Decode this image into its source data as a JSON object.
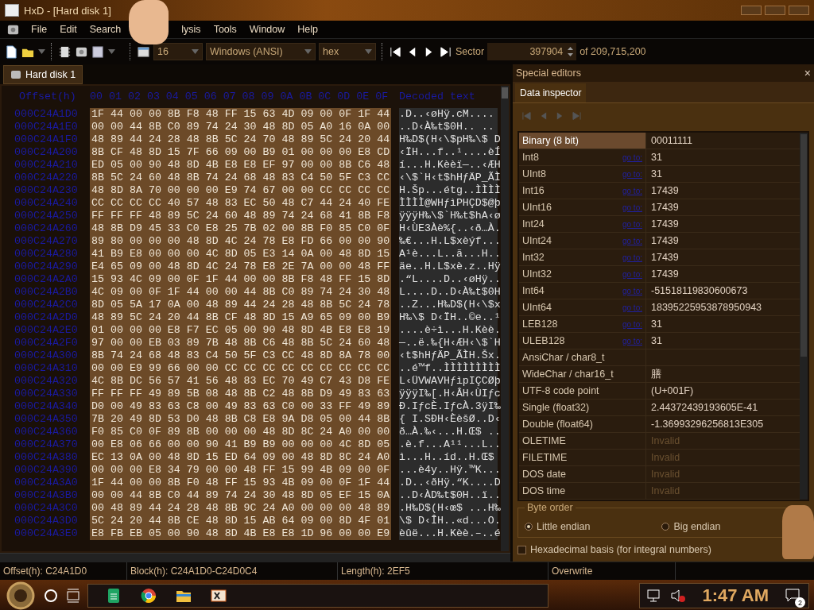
{
  "window": {
    "title": "HxD - [Hard disk 1]"
  },
  "menu": [
    "File",
    "Edit",
    "Search",
    "lysis",
    "Tools",
    "Window",
    "Help"
  ],
  "toolbar": {
    "bytes_per_row": "16",
    "charset": "Windows (ANSI)",
    "offset_base": "hex",
    "sector_label": "Sector",
    "sector": "397904",
    "sector_total": "of 209,715,200"
  },
  "tabs": [
    {
      "label": "Hard disk 1",
      "selected": true
    }
  ],
  "hex_view": {
    "offset_header": "Offset(h)",
    "columns": [
      "00",
      "01",
      "02",
      "03",
      "04",
      "05",
      "06",
      "07",
      "08",
      "09",
      "0A",
      "0B",
      "0C",
      "0D",
      "0E",
      "0F"
    ],
    "decoded_header": "Decoded text",
    "rows": [
      {
        "offset": "000C24A1D0",
        "bytes": "1F 44 00 00 8B F8 48 FF 15 63 4D 09 00 0F 1F 44",
        "text": ".D..‹øHÿ.cM...."
      },
      {
        "offset": "000C24A1E0",
        "bytes": "00 00 44 8B C0 89 74 24 30 48 8D 05 A0 16 0A 00",
        "text": "..D‹À‰t$0H.. .."
      },
      {
        "offset": "000C24A1F0",
        "bytes": "48 89 44 24 28 48 8B 5C 24 70 48 89 5C 24 20 44",
        "text": "H‰D$(H‹\\$pH‰\\$ D"
      },
      {
        "offset": "000C24A200",
        "bytes": "8B CF 48 8D 15 7F 66 09 00 B9 01 00 00 00 E8 CD",
        "text": "‹ÏH...f..¹....èÍ"
      },
      {
        "offset": "000C24A210",
        "bytes": "ED 05 00 90 48 8D 4B E8 E8 EF 97 00 00 8B C6 48",
        "text": "í...H.Kèèï—..‹ÆH"
      },
      {
        "offset": "000C24A220",
        "bytes": "8B 5C 24 60 48 8B 74 24 68 48 83 C4 50 5F C3 CC",
        "text": "‹\\$`H‹t$hHƒÄP_ÃÌ"
      },
      {
        "offset": "000C24A230",
        "bytes": "48 8D 8A 70 00 00 00 E9 74 67 00 00 CC CC CC CC",
        "text": "H.Šp...étg..ÌÌÌÌ"
      },
      {
        "offset": "000C24A240",
        "bytes": "CC CC CC CC 40 57 48 83 EC 50 48 C7 44 24 40 FE",
        "text": "ÌÌÌÌ@WHƒìPHÇD$@þ"
      },
      {
        "offset": "000C24A250",
        "bytes": "FF FF FF 48 89 5C 24 60 48 89 74 24 68 41 8B F8",
        "text": "ÿÿÿH‰\\$`H‰t$hA‹ø"
      },
      {
        "offset": "000C24A260",
        "bytes": "48 8B D9 45 33 C0 E8 25 7B 02 00 8B F0 85 C0 0F",
        "text": "H‹ÙE3Àè%{..‹ð…À."
      },
      {
        "offset": "000C24A270",
        "bytes": "89 80 00 00 00 48 8D 4C 24 78 E8 FD 66 00 00 90",
        "text": "‰€...H.L$xèýf..."
      },
      {
        "offset": "000C24A280",
        "bytes": "41 B9 E8 00 00 00 4C 8D 05 E3 14 0A 00 48 8D 15",
        "text": "A¹è...L..ã...H.."
      },
      {
        "offset": "000C24A290",
        "bytes": "E4 65 09 00 48 8D 4C 24 78 E8 2E 7A 00 00 48 FF",
        "text": "äe..H.L$xè.z..Hÿ"
      },
      {
        "offset": "000C24A2A0",
        "bytes": "15 93 4C 09 00 0F 1F 44 00 00 8B F8 48 FF 15 8D",
        "text": ".“L....D..‹øHÿ.."
      },
      {
        "offset": "000C24A2B0",
        "bytes": "4C 09 00 0F 1F 44 00 00 44 8B C0 89 74 24 30 48",
        "text": "L....D..D‹À‰t$0H"
      },
      {
        "offset": "000C24A2C0",
        "bytes": "8D 05 5A 17 0A 00 48 89 44 24 28 48 8B 5C 24 78",
        "text": "..Z...H‰D$(H‹\\$x"
      },
      {
        "offset": "000C24A2D0",
        "bytes": "48 89 5C 24 20 44 8B CF 48 8D 15 A9 65 09 00 B9",
        "text": "H‰\\$ D‹ÏH..©e..¹"
      },
      {
        "offset": "000C24A2E0",
        "bytes": "01 00 00 00 E8 F7 EC 05 00 90 48 8D 4B E8 E8 19",
        "text": "....è÷ì...H.Kèè."
      },
      {
        "offset": "000C24A2F0",
        "bytes": "97 00 00 EB 03 89 7B 48 8B C6 48 8B 5C 24 60 48",
        "text": "—..ë.‰{H‹ÆH‹\\$`H"
      },
      {
        "offset": "000C24A300",
        "bytes": "8B 74 24 68 48 83 C4 50 5F C3 CC 48 8D 8A 78 00",
        "text": "‹t$hHƒÄP_ÃÌH.Šx."
      },
      {
        "offset": "000C24A310",
        "bytes": "00 00 E9 99 66 00 00 CC CC CC CC CC CC CC CC CC",
        "text": "..é™f..ÌÌÌÌÌÌÌÌÌ"
      },
      {
        "offset": "000C24A320",
        "bytes": "4C 8B DC 56 57 41 56 48 83 EC 70 49 C7 43 D8 FE",
        "text": "L‹ÜVWAVHƒìpIÇCØþ"
      },
      {
        "offset": "000C24A330",
        "bytes": "FF FF FF 49 89 5B 08 48 8B C2 48 8B D9 49 83 63",
        "text": "ÿÿÿI‰[.H‹ÂH‹ÙIƒc"
      },
      {
        "offset": "000C24A340",
        "bytes": "D0 00 49 83 63 C8 00 49 83 63 C0 00 33 FF 49 89",
        "text": "Ð.IƒcÈ.IƒcÀ.3ÿI‰"
      },
      {
        "offset": "000C24A350",
        "bytes": "7B 20 49 8D 53 D0 48 8B C8 E8 9A D8 05 00 44 8B",
        "text": "{ I.SÐH‹ÈèšØ..D‹"
      },
      {
        "offset": "000C24A360",
        "bytes": "F0 85 C0 0F 89 8B 00 00 00 48 8D 8C 24 A0 00 00",
        "text": "ð…À.‰‹...H.Œ$ .."
      },
      {
        "offset": "000C24A370",
        "bytes": "00 E8 06 66 00 00 90 41 B9 B9 00 00 00 4C 8D 05",
        "text": ".è.f...A¹¹...L.."
      },
      {
        "offset": "000C24A380",
        "bytes": "EC 13 0A 00 48 8D 15 ED 64 09 00 48 8D 8C 24 A0",
        "text": "ì...H..íd..H.Œ$ "
      },
      {
        "offset": "000C24A390",
        "bytes": "00 00 00 E8 34 79 00 00 48 FF 15 99 4B 09 00 0F",
        "text": "...è4y..Hÿ.™K..."
      },
      {
        "offset": "000C24A3A0",
        "bytes": "1F 44 00 00 8B F0 48 FF 15 93 4B 09 00 0F 1F 44",
        "text": ".D..‹ðHÿ.“K....D"
      },
      {
        "offset": "000C24A3B0",
        "bytes": "00 00 44 8B C0 44 89 74 24 30 48 8D 05 EF 15 0A",
        "text": "..D‹ÀD‰t$0H..ï.."
      },
      {
        "offset": "000C24A3C0",
        "bytes": "00 48 89 44 24 28 48 8B 9C 24 A0 00 00 00 48 89",
        "text": ".H‰D$(H‹œ$ ...H‰"
      },
      {
        "offset": "000C24A3D0",
        "bytes": "5C 24 20 44 8B CE 48 8D 15 AB 64 09 00 8D 4F 01",
        "text": "\\$ D‹ÎH..«d...O."
      },
      {
        "offset": "000C24A3E0",
        "bytes": "E8 FB EB 05 00 90 48 8D 4B E8 E8 1D 96 00 00 E9",
        "text": "èûë...H.Kèè.–..é"
      }
    ]
  },
  "special_editors": {
    "title": "Special editors",
    "close": "×",
    "tabs": [
      {
        "label": "Data inspector",
        "selected": true
      }
    ],
    "rows": [
      {
        "type": "Binary (8 bit)",
        "value": "00011111",
        "selected": true,
        "disabled": false
      },
      {
        "type": "Int8",
        "link": "go to:",
        "value": "31",
        "selected": false,
        "disabled": false
      },
      {
        "type": "UInt8",
        "link": "go to:",
        "value": "31",
        "selected": false,
        "disabled": false
      },
      {
        "type": "Int16",
        "link": "go to:",
        "value": "17439",
        "selected": false,
        "disabled": false
      },
      {
        "type": "UInt16",
        "link": "go to:",
        "value": "17439",
        "selected": false,
        "disabled": false
      },
      {
        "type": "Int24",
        "link": "go to:",
        "value": "17439",
        "selected": false,
        "disabled": false
      },
      {
        "type": "UInt24",
        "link": "go to:",
        "value": "17439",
        "selected": false,
        "disabled": false
      },
      {
        "type": "Int32",
        "link": "go to:",
        "value": "17439",
        "selected": false,
        "disabled": false
      },
      {
        "type": "UInt32",
        "link": "go to:",
        "value": "17439",
        "selected": false,
        "disabled": false
      },
      {
        "type": "Int64",
        "link": "go to:",
        "value": "-51518119830600673",
        "selected": false,
        "disabled": false
      },
      {
        "type": "UInt64",
        "link": "go to:",
        "value": "18395225953878950943",
        "selected": false,
        "disabled": false
      },
      {
        "type": "LEB128",
        "link": "go to:",
        "value": "31",
        "selected": false,
        "disabled": false
      },
      {
        "type": "ULEB128",
        "link": "go to:",
        "value": "31",
        "selected": false,
        "disabled": false
      },
      {
        "type": "AnsiChar / char8_t",
        "selected": false
      },
      {
        "type": "WideChar / char16_t",
        "value": "膳",
        "selected": false,
        "disabled": false
      },
      {
        "type": "UTF-8 code point",
        "value": " (U+001F)",
        "selected": false,
        "disabled": false
      },
      {
        "type": "Single (float32)",
        "value": "2.44372439193605E-41",
        "selected": false,
        "disabled": false
      },
      {
        "type": "Double (float64)",
        "value": "-1.36993296256813E305",
        "selected": false,
        "disabled": false
      },
      {
        "type": "OLETIME",
        "value": "Invalid",
        "selected": false,
        "disabled": true
      },
      {
        "type": "FILETIME",
        "value": "Invalid",
        "selected": false,
        "disabled": true
      },
      {
        "type": "DOS date",
        "value": "Invalid",
        "selected": false,
        "disabled": true
      },
      {
        "type": "DOS time",
        "value": "Invalid",
        "selected": false,
        "disabled": true
      }
    ],
    "byte_order": {
      "label": "Byte order",
      "options": [
        {
          "label": "Little endian",
          "selected": true
        },
        {
          "label": "Big endian",
          "selected": false
        }
      ]
    },
    "hex_basis": {
      "label": "Hexadecimal basis (for integral numbers)",
      "checked": false
    }
  },
  "status_bar": [
    "Offset(h): C24A1D0",
    "Block(h): C24A1D0-C24D0C4",
    "Length(h): 2EF5",
    "Overwrite"
  ],
  "taskbar": {
    "apps": [
      {
        "kind": "document"
      },
      {
        "kind": "browser"
      },
      {
        "kind": "folder"
      },
      {
        "kind": "hexeditor"
      }
    ],
    "clock": "1:47 AM",
    "notifications": "2"
  }
}
